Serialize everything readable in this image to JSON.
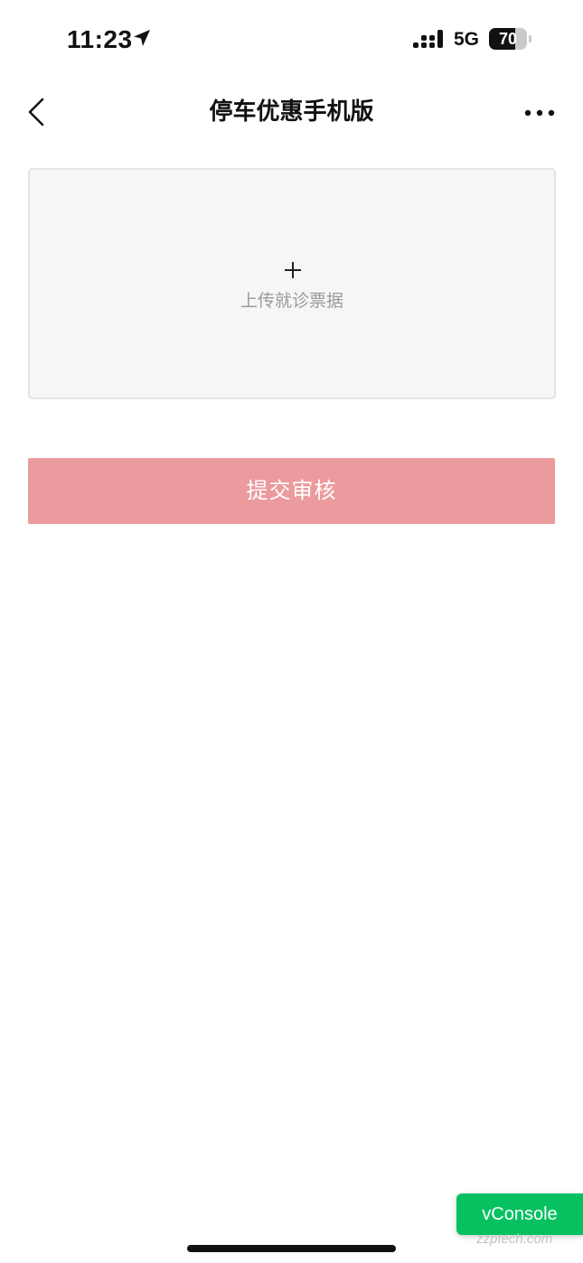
{
  "status_bar": {
    "time": "11:23",
    "network": "5G",
    "battery_level": "70",
    "battery_fraction": 0.7,
    "icons": [
      "location-arrow-icon",
      "signal-icon",
      "battery-icon"
    ]
  },
  "nav": {
    "title": "停车优惠手机版",
    "back_icon": "chevron-left-icon",
    "more_icon": "more-dots-icon"
  },
  "upload": {
    "icon": "plus-icon",
    "label": "上传就诊票据"
  },
  "submit": {
    "label": "提交审核"
  },
  "vconsole": {
    "label": "vConsole"
  },
  "watermark": {
    "text": "zzptech.com"
  },
  "colors": {
    "submit_background": "#eb9a9d",
    "vconsole_background": "#07c160",
    "upload_background": "#f6f6f6",
    "upload_label": "#9a9a9a"
  }
}
